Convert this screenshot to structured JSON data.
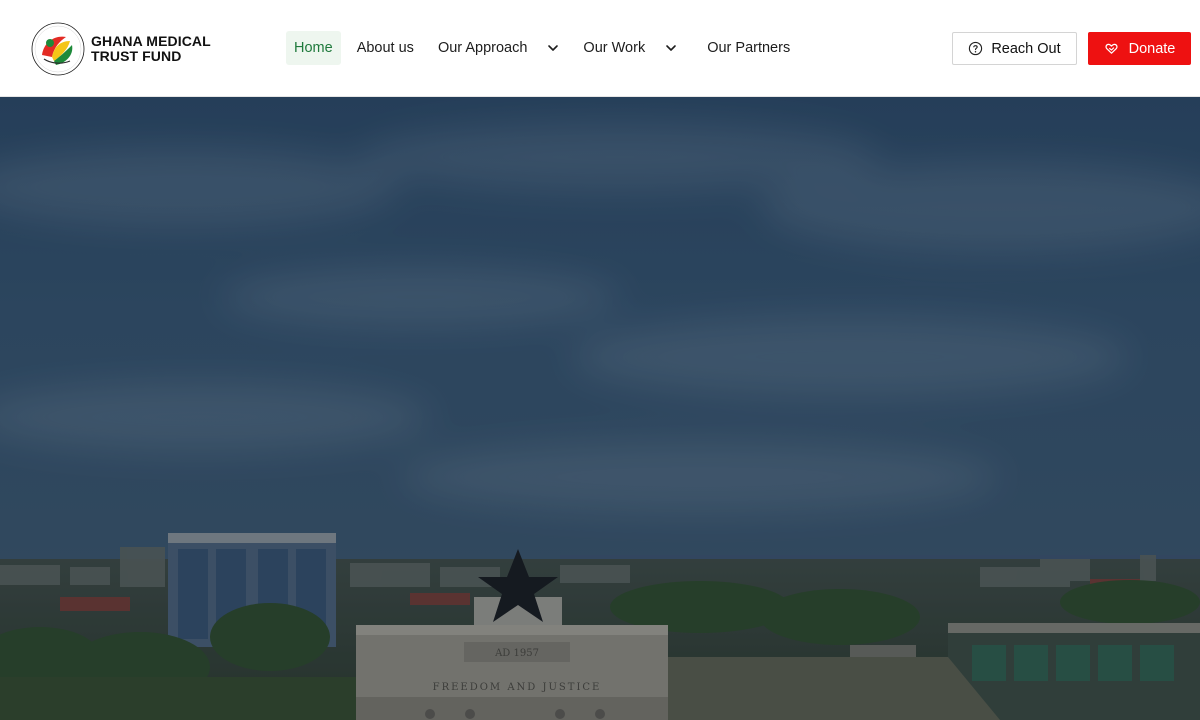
{
  "brand": {
    "name_line1": "GHANA MEDICAL",
    "name_line2": "TRUST FUND",
    "logo_icon": "ghana-medical-trust-fund-logo"
  },
  "nav": {
    "items": [
      {
        "label": "Home",
        "active": true,
        "has_dropdown": false
      },
      {
        "label": "About us",
        "active": false,
        "has_dropdown": false
      },
      {
        "label": "Our Approach",
        "active": false,
        "has_dropdown": true
      },
      {
        "label": "Our Work",
        "active": false,
        "has_dropdown": true
      },
      {
        "label": "Our Partners",
        "active": false,
        "has_dropdown": false
      }
    ]
  },
  "actions": {
    "reach_out_label": "Reach Out",
    "reach_out_icon": "question-circle-icon",
    "donate_label": "Donate",
    "donate_icon": "heart-hand-icon"
  },
  "hero": {
    "image": "Black Star Square, Accra aerial view",
    "arch_text_top": "AD 1957",
    "arch_text_bottom": "FREEDOM AND JUSTICE"
  },
  "colors": {
    "accent_green": "#1f7a3c",
    "active_bg": "#eef6ef",
    "donate_red": "#ee1111",
    "sky_dark": "#2f4f6e"
  }
}
